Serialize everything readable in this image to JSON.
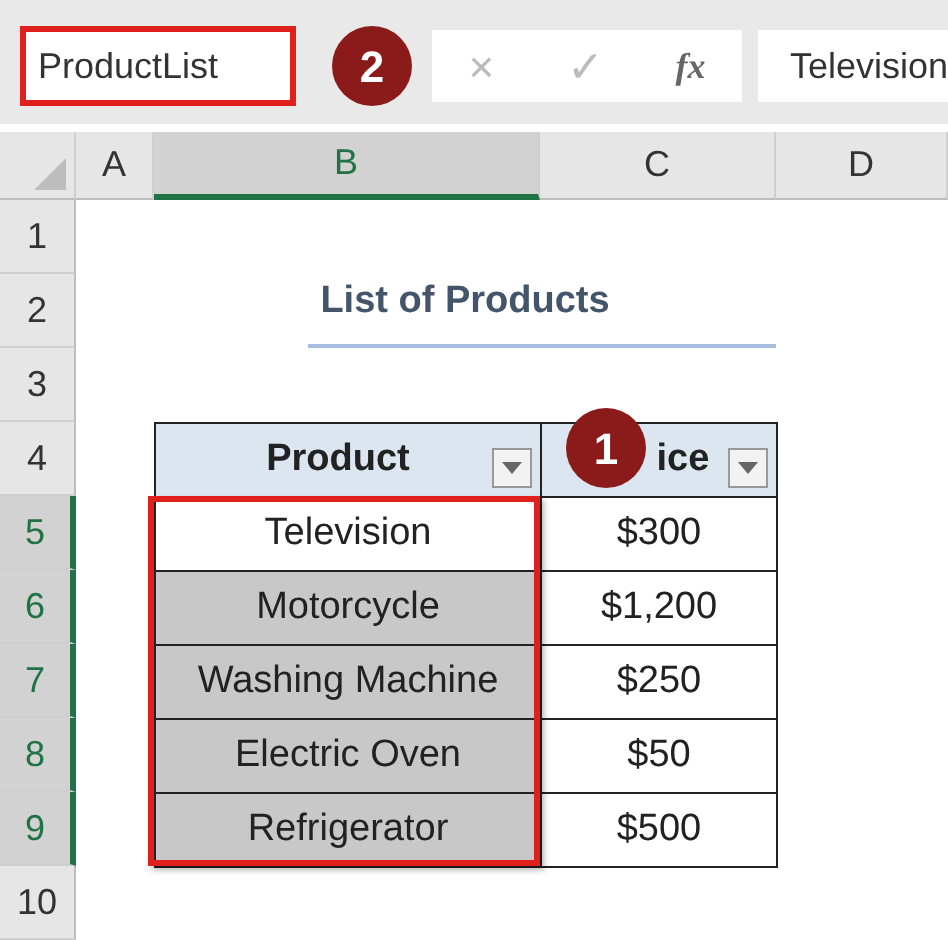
{
  "name_box": {
    "value": "ProductList",
    "highlighted": true,
    "callout": "2"
  },
  "formula_bar": {
    "cancel": "×",
    "enter": "✓",
    "function_label": "fx",
    "value": "Television"
  },
  "columns": [
    {
      "label": "A",
      "selected": false
    },
    {
      "label": "B",
      "selected": true
    },
    {
      "label": "C",
      "selected": false
    },
    {
      "label": "D",
      "selected": false
    }
  ],
  "rows": [
    {
      "label": "1",
      "selected": false
    },
    {
      "label": "2",
      "selected": false
    },
    {
      "label": "3",
      "selected": false
    },
    {
      "label": "4",
      "selected": false
    },
    {
      "label": "5",
      "selected": true
    },
    {
      "label": "6",
      "selected": true
    },
    {
      "label": "7",
      "selected": true
    },
    {
      "label": "8",
      "selected": true
    },
    {
      "label": "9",
      "selected": true
    },
    {
      "label": "10",
      "selected": false
    }
  ],
  "title": "List of Products",
  "table": {
    "columns": [
      {
        "label": "Product",
        "filter": true
      },
      {
        "label": "ice",
        "filter": true,
        "callout": "1"
      }
    ],
    "rows": [
      {
        "product": "Television",
        "price": "$300",
        "selected": true,
        "active": true
      },
      {
        "product": "Motorcycle",
        "price": "$1,200",
        "selected": true,
        "active": false
      },
      {
        "product": "Washing Machine",
        "price": "$250",
        "selected": true,
        "active": false
      },
      {
        "product": "Electric Oven",
        "price": "$50",
        "selected": true,
        "active": false
      },
      {
        "product": "Refrigerator",
        "price": "$500",
        "selected": true,
        "active": false
      }
    ]
  }
}
